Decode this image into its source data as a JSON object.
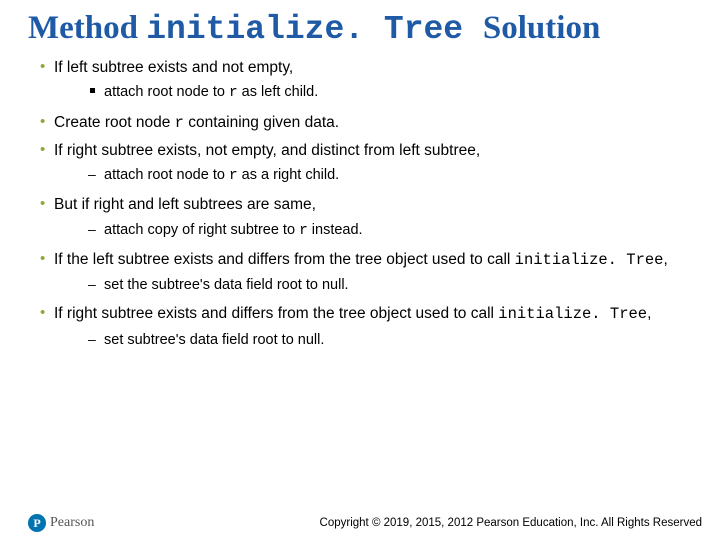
{
  "title": {
    "pre": "Method ",
    "mono": "initialize. Tree ",
    "post": "Solution"
  },
  "bullets": [
    {
      "text": "If left subtree exists and not empty,",
      "sub": [
        {
          "style": "square",
          "pre": "attach root node to ",
          "mono": "r",
          "post": " as left child."
        }
      ]
    },
    {
      "pre": "Create root node ",
      "mono": "r",
      "post": " containing given data.",
      "sub": []
    },
    {
      "text": "If right subtree exists, not empty, and distinct from left subtree,",
      "sub": [
        {
          "style": "dash",
          "pre": "attach root node to ",
          "mono": "r",
          "post": " as a right child."
        }
      ]
    },
    {
      "text": "But if right and left subtrees are same,",
      "sub": [
        {
          "style": "dash",
          "pre": "attach copy of right subtree to ",
          "mono": "r",
          "post": "  instead."
        }
      ]
    },
    {
      "pre": "If the left subtree exists and differs from the tree object used to call ",
      "mono": "initialize. Tree",
      "post": ",",
      "sub": [
        {
          "style": "dash",
          "text": "set the subtree's data field root to null."
        }
      ]
    },
    {
      "pre": "If right subtree exists and differs from the tree object used to call ",
      "mono": "initialize. Tree",
      "post": ",",
      "sub": [
        {
          "style": "dash",
          "text": "set subtree's data field root to null."
        }
      ]
    }
  ],
  "logo_text": "Pearson",
  "copyright": "Copyright © 2019, 2015, 2012 Pearson Education, Inc. All Rights Reserved"
}
